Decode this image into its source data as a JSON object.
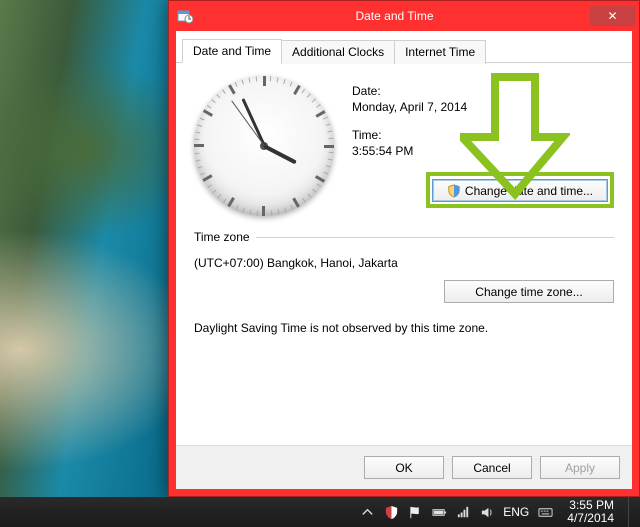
{
  "window": {
    "title": "Date and Time",
    "close_glyph": "✕"
  },
  "tabs": [
    "Date and Time",
    "Additional Clocks",
    "Internet Time"
  ],
  "datetime": {
    "date_label": "Date:",
    "date_value": "Monday, April 7, 2014",
    "time_label": "Time:",
    "time_value": "3:55:54 PM",
    "change_btn": "Change date and time..."
  },
  "timezone": {
    "legend": "Time zone",
    "value": "(UTC+07:00) Bangkok, Hanoi, Jakarta",
    "change_btn": "Change time zone...",
    "dst": "Daylight Saving Time is not observed by this time zone."
  },
  "dialog": {
    "ok": "OK",
    "cancel": "Cancel",
    "apply": "Apply"
  },
  "taskbar": {
    "lang": "ENG",
    "time": "3:55 PM",
    "date": "4/7/2014"
  },
  "clock": {
    "hour": 3,
    "minute": 55,
    "second": 54,
    "pm": true
  },
  "colors": {
    "accent": "#ff3030",
    "highlight": "#8bc220"
  }
}
